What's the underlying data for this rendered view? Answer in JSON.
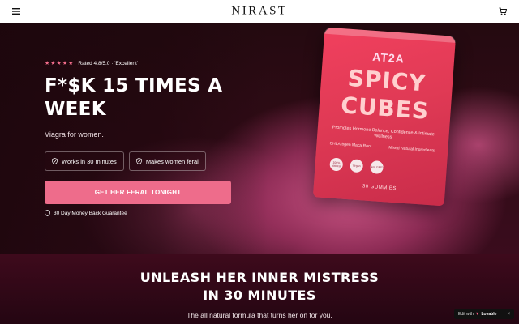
{
  "header": {
    "brand": "NIRAST",
    "menu_icon": "menu-icon",
    "cart_icon": "cart-icon"
  },
  "hero": {
    "rating": {
      "stars": "★★★★★",
      "text": "Rated 4.8/5.0 · 'Excellent'"
    },
    "headline": "F*$K 15 TIMES A WEEK",
    "subhead": "Viagra for women.",
    "badges": [
      {
        "icon": "shield-check-icon",
        "label": "Works in 30 minutes"
      },
      {
        "icon": "shield-check-icon",
        "label": "Makes women feral"
      }
    ],
    "cta": "GET HER FERAL TONIGHT",
    "guarantee": {
      "icon": "shield-icon",
      "text": "30 Day Money Back Guarantee"
    },
    "product": {
      "brand": "AT2A",
      "name_line1": "SPICY",
      "name_line2": "CUBES",
      "tagline": "Promotes Hormone Balance, Confidence & Intimate Wellness",
      "bullets": [
        "CHLArbgen Maca Root",
        "Mixed Natural Ingredients"
      ],
      "seals": [
        "100% Natural",
        "Vegan",
        "Non GMO"
      ],
      "count": "30 GUMMIES"
    }
  },
  "section": {
    "title_line1": "UNLEASH HER INNER MISTRESS",
    "title_line2": "IN 30 MINUTES",
    "subtitle": "The all natural formula that turns her on for you."
  },
  "lovable": {
    "prefix": "Edit with",
    "brand": "Lovable",
    "close": "×"
  },
  "colors": {
    "accent": "#ee6c8b",
    "dark": "#1a0409",
    "pouch": "#e03a55"
  }
}
